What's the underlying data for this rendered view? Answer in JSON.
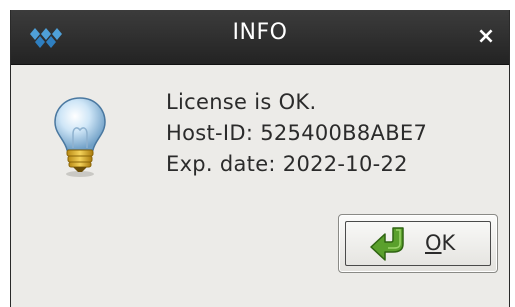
{
  "window": {
    "title": "INFO",
    "close_glyph": "×"
  },
  "message": {
    "line1": "License is OK.",
    "line2": "Host-ID: 525400B8ABE7",
    "line3": "Exp. date: 2022-10-22"
  },
  "icons": {
    "app": "app-logo-icon",
    "info": "lightbulb-icon",
    "ok": "green-arrow-icon",
    "close": "close-icon"
  },
  "ok_button": {
    "mnemonic": "O",
    "label_rest": "K"
  },
  "colors": {
    "titlebar": "#2e2e2e",
    "dialog_bg": "#ecebe8",
    "text": "#2b2b2b",
    "accent_green": "#5aa02c"
  }
}
